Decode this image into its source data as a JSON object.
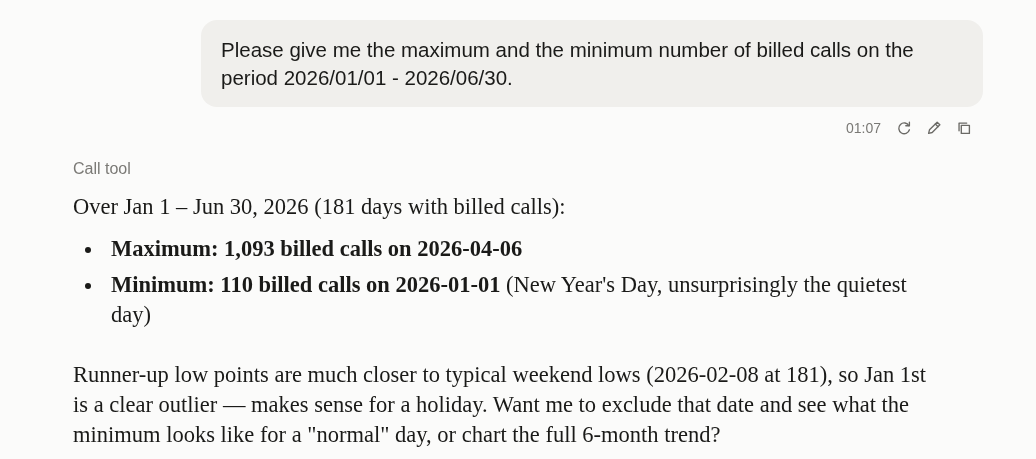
{
  "user_message": {
    "text": "Please give me the maximum and the minimum number of billed calls on the period 2026/01/01 - 2026/06/30.",
    "time": "01:07"
  },
  "tool_label": "Call tool",
  "reply": {
    "intro": "Over Jan 1 – Jun 30, 2026 (181 days with billed calls):",
    "bullets": [
      {
        "text": "Maximum: 1,093 billed calls on 2026-04-06",
        "bold": true
      },
      {
        "text": "**Minimum: 110 billed calls on 2026-01-01** (New Year's Day, unsurprisingly the quietest day)",
        "bold": false
      }
    ],
    "closing": "Runner-up low points are much closer to typical weekend lows (2026-02-08 at 181), so Jan 1st is a clear outlier — makes sense for a holiday. Want me to exclude that date and see what the minimum looks like for a \"normal\" day, or chart the full 6-month trend?"
  }
}
